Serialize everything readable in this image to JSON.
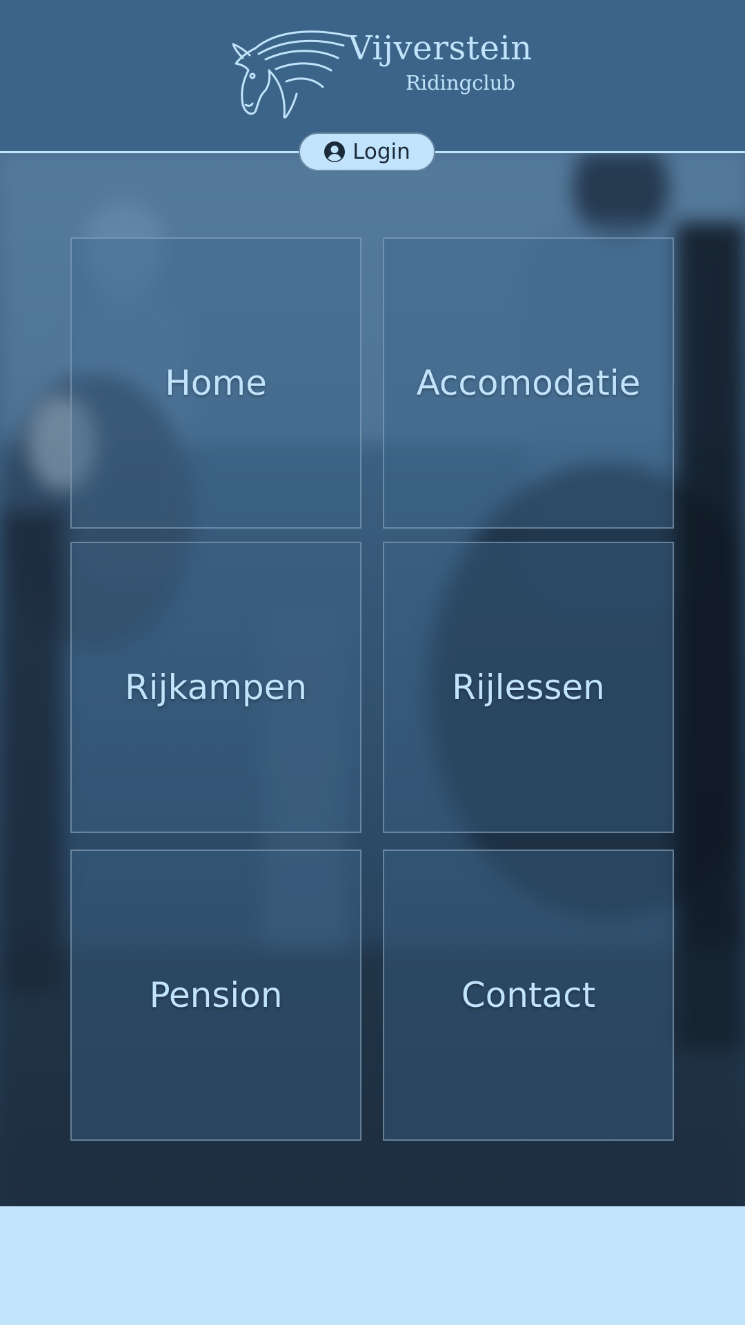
{
  "header": {
    "logo": {
      "title": "Vijverstein",
      "subtitle": "Ridingclub",
      "icon": "horse-head-icon"
    },
    "login": {
      "label": "Login",
      "icon": "user-circle-icon"
    }
  },
  "tiles": [
    {
      "label": "Home"
    },
    {
      "label": "Accomodatie"
    },
    {
      "label": "Rijkampen"
    },
    {
      "label": "Rijlessen"
    },
    {
      "label": "Pension"
    },
    {
      "label": "Contact"
    }
  ],
  "colors": {
    "header_bg": "#3c6488",
    "accent_light": "#c1e3fc",
    "tile_text": "#c1e3fc",
    "footer_bg": "#c1e3fc"
  }
}
